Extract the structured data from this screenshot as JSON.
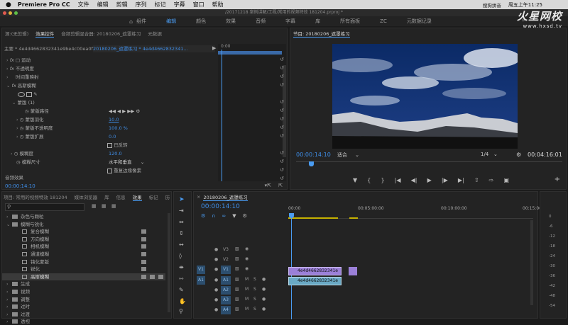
{
  "menubar": {
    "apple": "",
    "app": "Premiere Pro CC",
    "items": [
      "文件",
      "编辑",
      "剪辑",
      "序列",
      "标记",
      "字幕",
      "窗口",
      "帮助"
    ],
    "clock": "周五上午11:25",
    "input": "搜狗拼音"
  },
  "window": {
    "path": "/20171218 案例讲解/工程/常用的视频特效 181204.prproj *"
  },
  "workspaces": [
    "组件",
    "编辑",
    "颜色",
    "效果",
    "音频",
    "字幕",
    "库",
    "所有面板",
    "ZC",
    "元数据记录"
  ],
  "workspace_active": 1,
  "watermark": {
    "brand": "火星网校",
    "url": "www.hxsd.tv"
  },
  "effect_controls": {
    "tabs": [
      "源:(无剪辑)",
      "效果控件",
      "音频剪辑混合器: 20180206_遮罩练习",
      "元数据"
    ],
    "active_tab": 1,
    "master": "主要 * 4e4d4662832341e9be4c00ea0ff6cd...",
    "sequence": "20180206_遮罩练习 * 4e4d4662832341...",
    "ruler": "0:00",
    "rows": [
      {
        "label": "运动",
        "fx": true
      },
      {
        "label": "不透明度",
        "fx": true
      },
      {
        "label": "时间重映射",
        "fx": false
      },
      {
        "label": "高斯模糊",
        "fx": true
      },
      {
        "label": "蒙版 (1)",
        "fx": false
      },
      {
        "label": "蒙版路径",
        "fx": false
      },
      {
        "label": "蒙版羽化",
        "value": "10.0"
      },
      {
        "label": "蒙版不透明度",
        "value": "100.0 %"
      },
      {
        "label": "蒙版扩展",
        "value": "0.0"
      },
      {
        "label": "已反转",
        "checkbox": true
      },
      {
        "label": "模糊度",
        "value": "120.0"
      },
      {
        "label": "模糊尺寸",
        "value": "水平和垂直"
      },
      {
        "label": "重复边缘像素",
        "checkbox": true
      }
    ],
    "audio_effects": "音频效果",
    "timecode": "00:00:14:10"
  },
  "program": {
    "title": "节目: 20180206_遮罩练习",
    "timecode": "00:00:14:10",
    "fit": "适合",
    "quality": "1/4",
    "duration": "00:04:16:01"
  },
  "project": {
    "tabs": [
      "项目: 常用的视频特效 181204",
      "媒体浏览器",
      "库",
      "信息",
      "效果",
      "标记",
      "历"
    ],
    "active_tab": 4,
    "folders": [
      {
        "label": "杂色与颗粒",
        "type": "folder",
        "level": 1
      },
      {
        "label": "模糊与锐化",
        "type": "folder",
        "level": 1,
        "open": true
      },
      {
        "label": "复合模糊",
        "type": "fx",
        "level": 2
      },
      {
        "label": "方向模糊",
        "type": "fx",
        "level": 2
      },
      {
        "label": "相机模糊",
        "type": "fx",
        "level": 2
      },
      {
        "label": "通道模糊",
        "type": "fx",
        "level": 2
      },
      {
        "label": "钝化蒙版",
        "type": "fx",
        "level": 2
      },
      {
        "label": "锐化",
        "type": "fx",
        "level": 2
      },
      {
        "label": "高斯模糊",
        "type": "fx",
        "level": 2,
        "selected": true
      },
      {
        "label": "生成",
        "type": "folder",
        "level": 1
      },
      {
        "label": "视频",
        "type": "folder",
        "level": 1
      },
      {
        "label": "调整",
        "type": "folder",
        "level": 1
      },
      {
        "label": "过时",
        "type": "folder",
        "level": 1
      },
      {
        "label": "过渡",
        "type": "folder",
        "level": 1
      },
      {
        "label": "透视",
        "type": "folder",
        "level": 1
      }
    ]
  },
  "timeline": {
    "title": "20180206_遮罩练习",
    "timecode": "00:00:14:10",
    "ruler": [
      "00:00",
      "00:05:00:00",
      "00:10:00:00",
      "00:15:00:00"
    ],
    "video_tracks": [
      "V3",
      "V2",
      "V1"
    ],
    "audio_tracks": [
      "A1",
      "A2",
      "A3",
      "A4"
    ],
    "clip_v1": "4e4d4662832341e",
    "clip_a1": "4e4d4662832341e",
    "meter_labels": [
      "0",
      "-6",
      "-12",
      "-18",
      "-24",
      "-30",
      "-36",
      "-42",
      "-48",
      "-54"
    ]
  },
  "colors": {
    "accent": "#4a9cf2",
    "clip_video": "#9b80d8",
    "clip_audio": "#6aa9c4",
    "work_bar": "#c6b200"
  }
}
